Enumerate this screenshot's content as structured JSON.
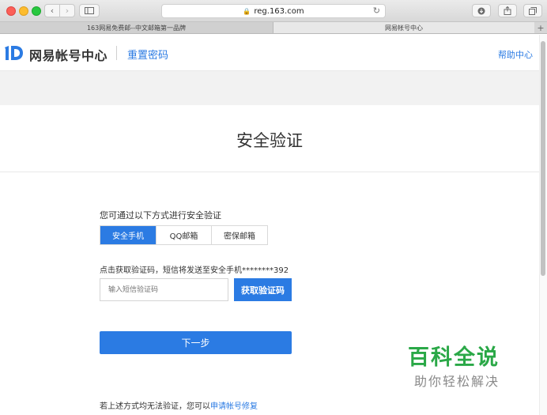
{
  "browser": {
    "url": "reg.163.com",
    "tabs": [
      {
        "title": "163网易免费邮--中文邮箱第一品牌"
      },
      {
        "title": "网易帐号中心"
      }
    ]
  },
  "header": {
    "logo_text": "网易帐号中心",
    "subtitle": "重置密码",
    "help_link": "帮助中心"
  },
  "page": {
    "title": "安全验证",
    "prompt": "您可通过以下方式进行安全验证",
    "verify_tabs": [
      {
        "label": "安全手机",
        "active": true
      },
      {
        "label": "QQ邮箱",
        "active": false
      },
      {
        "label": "密保邮箱",
        "active": false
      }
    ],
    "sms_info": "点击获取验证码，短信将发送至安全手机********392",
    "sms_input_placeholder": "输入短信验证码",
    "get_code_label": "获取验证码",
    "next_label": "下一步",
    "footer_text": "若上述方式均无法验证，您可以",
    "footer_link": "申请帐号修复"
  },
  "watermark": {
    "main": "百科全说",
    "sub": "助你轻松解决"
  },
  "colors": {
    "accent": "#2b7be3",
    "watermark_green": "#2aa847"
  }
}
